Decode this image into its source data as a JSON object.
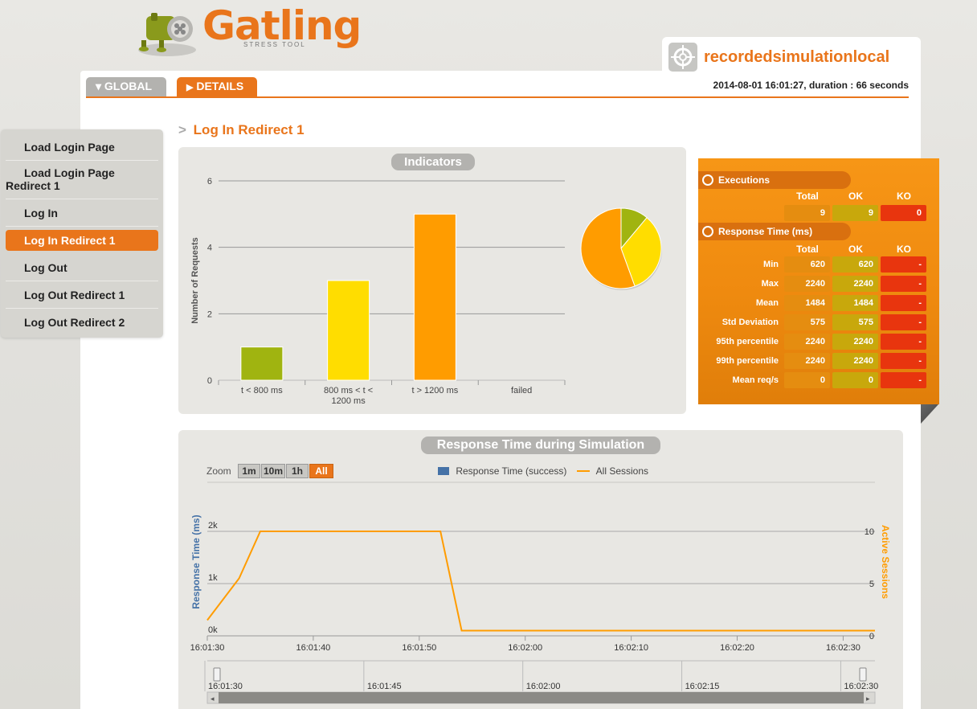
{
  "brand": {
    "name": "Gatling",
    "tagline": "STRESS TOOL",
    "accent": "#e9751b"
  },
  "simulation": {
    "name": "recordedsimulationlocal",
    "run_info": "2014-08-01 16:01:27, duration : 66 seconds"
  },
  "tabs": [
    {
      "label": "GLOBAL",
      "icon": "triangle-down-icon",
      "active": false
    },
    {
      "label": "DETAILS",
      "icon": "triangle-right-icon",
      "active": true
    }
  ],
  "sidebar": {
    "items": [
      {
        "label": "Load Login Page",
        "active": false
      },
      {
        "label": "Load Login Page",
        "label2": "Redirect 1",
        "active": false
      },
      {
        "label": "Log In",
        "active": false
      },
      {
        "label": "Log In Redirect 1",
        "active": true
      },
      {
        "label": "Log Out",
        "active": false
      },
      {
        "label": "Log Out Redirect 1",
        "active": false
      },
      {
        "label": "Log Out Redirect 2",
        "active": false
      }
    ]
  },
  "page": {
    "crumb_separator": ">",
    "title": "Log In Redirect 1"
  },
  "indicators": {
    "title": "Indicators",
    "chart_data": {
      "type": "bar",
      "title": "Indicators",
      "ylabel": "Number of Requests",
      "xlabel": "",
      "ylim": [
        0,
        6
      ],
      "yticks": [
        "0",
        "2",
        "4",
        "6"
      ],
      "categories": [
        "t < 800 ms",
        "800 ms < t < 1200 ms",
        "t > 1200 ms",
        "failed"
      ],
      "category_lines": [
        [
          "t < 800 ms"
        ],
        [
          "800 ms < t <",
          "1200 ms"
        ],
        [
          "t > 1200 ms"
        ],
        [
          "failed"
        ]
      ],
      "values": [
        1,
        3,
        5,
        0
      ],
      "colors": [
        "#a0b410",
        "#ffdd00",
        "#ff9c00",
        "#e8350e"
      ]
    },
    "pie_data": {
      "type": "pie",
      "values": [
        1,
        3,
        5
      ],
      "colors": [
        "#a0b410",
        "#ffdd00",
        "#ff9c00"
      ]
    }
  },
  "stats": {
    "executions": {
      "title": "Executions",
      "columns": [
        "Total",
        "OK",
        "KO"
      ],
      "values": [
        "9",
        "9",
        "0"
      ]
    },
    "response_time": {
      "title": "Response Time (ms)",
      "columns": [
        "Total",
        "OK",
        "KO"
      ],
      "rows": [
        {
          "label": "Min",
          "total": "620",
          "ok": "620",
          "ko": "-"
        },
        {
          "label": "Max",
          "total": "2240",
          "ok": "2240",
          "ko": "-"
        },
        {
          "label": "Mean",
          "total": "1484",
          "ok": "1484",
          "ko": "-"
        },
        {
          "label": "Std Deviation",
          "total": "575",
          "ok": "575",
          "ko": "-"
        },
        {
          "label": "95th percentile",
          "total": "2240",
          "ok": "2240",
          "ko": "-"
        },
        {
          "label": "99th percentile",
          "total": "2240",
          "ok": "2240",
          "ko": "-"
        },
        {
          "label": "Mean req/s",
          "total": "0",
          "ok": "0",
          "ko": "-"
        }
      ]
    }
  },
  "response_chart": {
    "title": "Response Time during Simulation",
    "zoom_label": "Zoom",
    "zoom_buttons": [
      {
        "label": "1m",
        "active": false
      },
      {
        "label": "10m",
        "active": false
      },
      {
        "label": "1h",
        "active": false
      },
      {
        "label": "All",
        "active": true
      }
    ],
    "legend": [
      {
        "label": "Response Time (success)",
        "color": "#4572a7",
        "shape": "square"
      },
      {
        "label": "All Sessions",
        "color": "#ff9c00",
        "shape": "line"
      }
    ],
    "chart_data": {
      "type": "line",
      "title": "Response Time during Simulation",
      "ylabel": "Response Time (ms)",
      "y2label": "Active Sessions",
      "left_ticks": [
        "0k",
        "1k",
        "2k"
      ],
      "right_ticks": [
        "0",
        "5",
        "10"
      ],
      "ylim_left": [
        0,
        2000
      ],
      "ylim_right": [
        0,
        10
      ],
      "xlim": [
        "16:01:30",
        "16:02:33"
      ],
      "x_ticks": [
        "16:01:30",
        "16:01:40",
        "16:01:50",
        "16:02:00",
        "16:02:10",
        "16:02:20",
        "16:02:30"
      ],
      "series": [
        {
          "name": "All Sessions",
          "color": "#ff9c00",
          "axis": "right",
          "x": [
            "16:01:30",
            "16:01:33",
            "16:01:35",
            "16:01:52",
            "16:01:54",
            "16:02:33"
          ],
          "values": [
            1.5,
            5.5,
            10,
            10,
            0.5,
            0.5
          ]
        }
      ]
    },
    "navigator": {
      "ticks": [
        "16:01:30",
        "16:01:45",
        "16:02:00",
        "16:02:15",
        "16:02:30"
      ]
    }
  }
}
